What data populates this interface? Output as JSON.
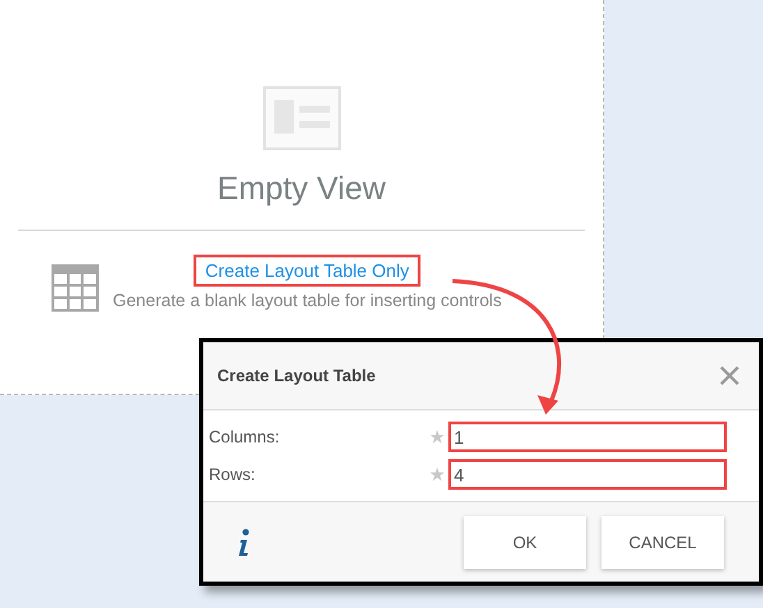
{
  "view": {
    "title": "Empty View",
    "link": "Create Layout Table Only",
    "description": "Generate a blank layout table for inserting controls"
  },
  "dialog": {
    "title": "Create Layout Table",
    "fields": [
      {
        "label": "Columns:",
        "value": "1",
        "required": true
      },
      {
        "label": "Rows:",
        "value": "4",
        "required": true
      }
    ],
    "buttons": [
      "OK",
      "CANCEL"
    ]
  }
}
